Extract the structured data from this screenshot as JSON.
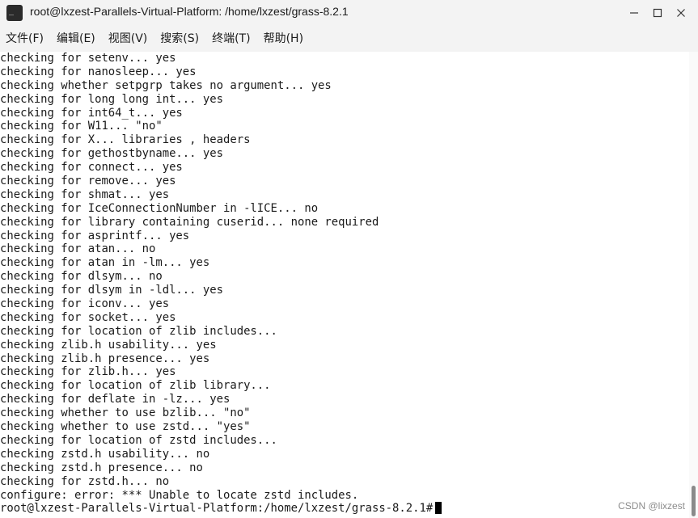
{
  "window": {
    "title": "root@lxzest-Parallels-Virtual-Platform: /home/lxzest/grass-8.2.1",
    "minimize_glyph": "—",
    "maximize_glyph": "☐",
    "close_glyph": "✕",
    "icon_glyph": "_"
  },
  "menu": {
    "items": [
      {
        "label": "文件(F)"
      },
      {
        "label": "编辑(E)"
      },
      {
        "label": "视图(V)"
      },
      {
        "label": "搜索(S)"
      },
      {
        "label": "终端(T)"
      },
      {
        "label": "帮助(H)"
      }
    ]
  },
  "terminal": {
    "lines": [
      "checking for setenv... yes",
      "checking for nanosleep... yes",
      "checking whether setpgrp takes no argument... yes",
      "checking for long long int... yes",
      "checking for int64_t... yes",
      "checking for W11... \"no\"",
      "checking for X... libraries , headers",
      "checking for gethostbyname... yes",
      "checking for connect... yes",
      "checking for remove... yes",
      "checking for shmat... yes",
      "checking for IceConnectionNumber in -lICE... no",
      "checking for library containing cuserid... none required",
      "checking for asprintf... yes",
      "checking for atan... no",
      "checking for atan in -lm... yes",
      "checking for dlsym... no",
      "checking for dlsym in -ldl... yes",
      "checking for iconv... yes",
      "checking for socket... yes",
      "checking for location of zlib includes...",
      "checking zlib.h usability... yes",
      "checking zlib.h presence... yes",
      "checking for zlib.h... yes",
      "checking for location of zlib library...",
      "checking for deflate in -lz... yes",
      "checking whether to use bzlib... \"no\"",
      "checking whether to use zstd... \"yes\"",
      "checking for location of zstd includes...",
      "checking zstd.h usability... no",
      "checking zstd.h presence... no",
      "checking for zstd.h... no",
      "configure: error: *** Unable to locate zstd includes."
    ],
    "prompt": "root@lxzest-Parallels-Virtual-Platform:/home/lxzest/grass-8.2.1#"
  },
  "watermark": "CSDN @lixzest"
}
